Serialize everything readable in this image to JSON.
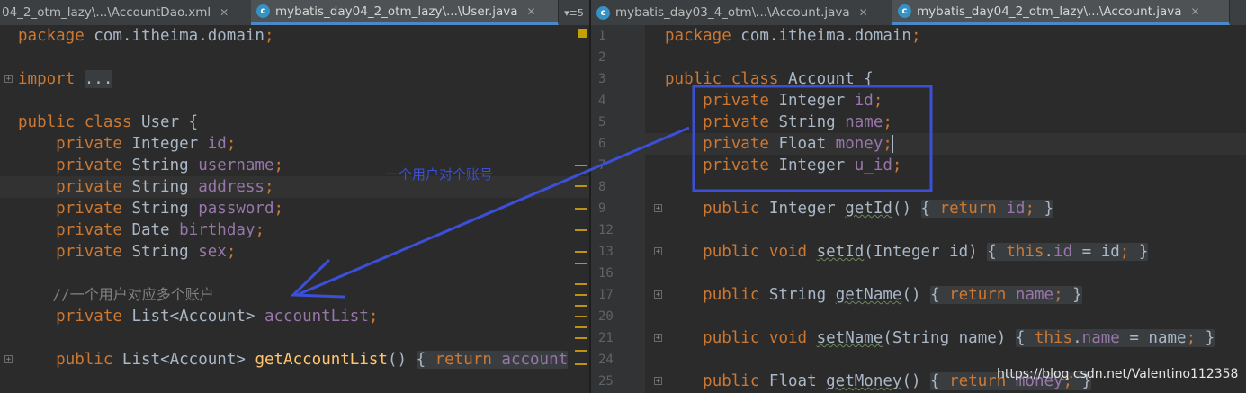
{
  "left_pane": {
    "tabs": [
      {
        "label": "04_2_otm_lazy\\...\\AccountDao.xml",
        "icon": "xml-file-icon",
        "active": false
      },
      {
        "label": "mybatis_day04_2_otm_lazy\\...\\User.java",
        "icon": "java-class-icon",
        "active": true
      }
    ],
    "tab_menu": "▾≡5",
    "lines": [
      [
        "package com.itheima.domain;"
      ],
      [
        ""
      ],
      [
        "import ..."
      ],
      [
        ""
      ],
      [
        "public class User {"
      ],
      [
        "    private Integer id;"
      ],
      [
        "    private String username;"
      ],
      [
        "    private String address;"
      ],
      [
        "    private String password;"
      ],
      [
        "    private Date birthday;"
      ],
      [
        "    private String sex;"
      ],
      [
        ""
      ],
      [
        "    //一个用户对应多个账户"
      ],
      [
        "    private List<Account> accountList;"
      ],
      [
        ""
      ],
      [
        "    public List<Account> getAccountList() { return account"
      ]
    ]
  },
  "right_pane": {
    "tabs": [
      {
        "label": "mybatis_day03_4_otm\\...\\Account.java",
        "icon": "java-class-icon",
        "active": false
      },
      {
        "label": "mybatis_day04_2_otm_lazy\\...\\Account.java",
        "icon": "java-class-icon",
        "active": true
      }
    ],
    "line_numbers": [
      "1",
      "2",
      "3",
      "4",
      "5",
      "6",
      "7",
      "8",
      "9",
      "12",
      "13",
      "16",
      "17",
      "20",
      "21",
      "24",
      "25"
    ],
    "lines": [
      "package com.itheima.domain;",
      "",
      "public class Account {",
      "    private Integer id;",
      "    private String name;",
      "    private Float money;",
      "    private Integer u_id;",
      "",
      "    public Integer getId() { return id; }",
      "",
      "    public void setId(Integer id) { this.id = id; }",
      "",
      "    public String getName() { return name; }",
      "",
      "    public void setName(String name) { this.name = name; }",
      "",
      "    public Float getMoney() { return money; }"
    ]
  },
  "annotation": {
    "text": "一个用户对个账号",
    "color": "#3b4fd8"
  },
  "watermark": "https://blog.csdn.net/Valentino112358",
  "colors": {
    "keyword": "#cc7832",
    "field": "#9876aa",
    "method": "#ffc66d",
    "comment": "#808080",
    "text": "#a9b7c6",
    "background": "#2b2b2b"
  }
}
